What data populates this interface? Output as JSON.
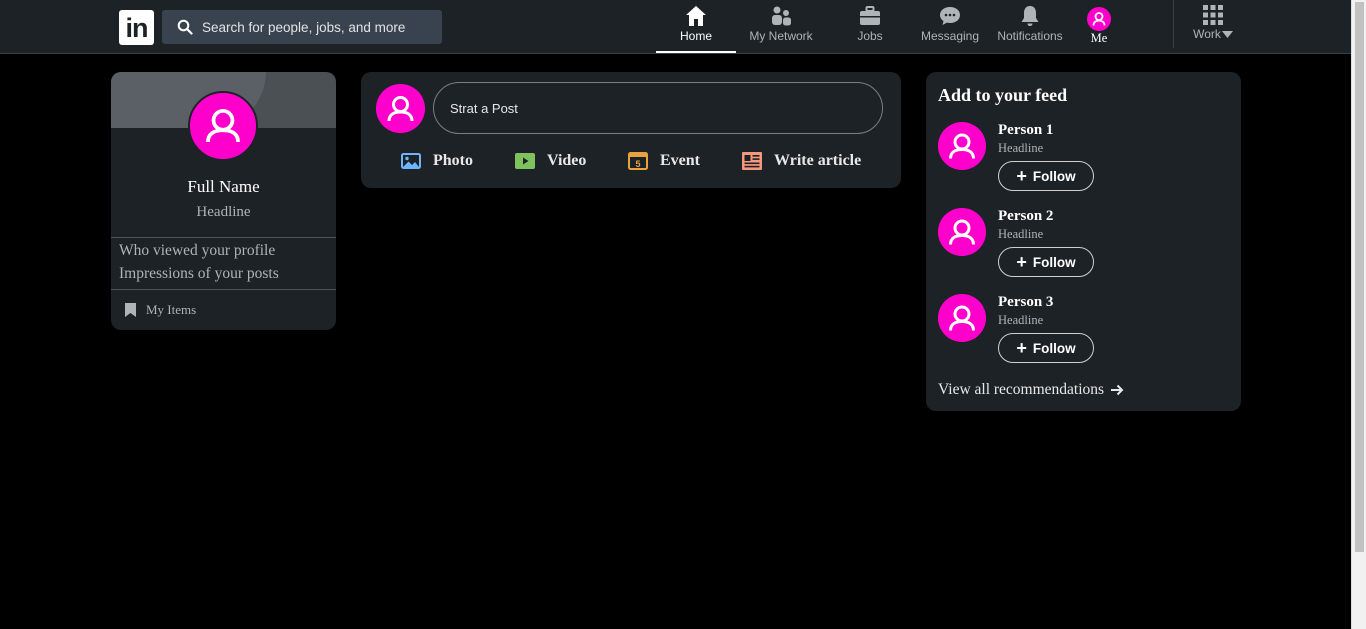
{
  "header": {
    "logo_text": "in",
    "search_placeholder": "Search for people, jobs, and more",
    "nav": [
      {
        "label": "Home",
        "icon": "home-icon",
        "active": true
      },
      {
        "label": "My Network",
        "icon": "network-icon",
        "active": false
      },
      {
        "label": "Jobs",
        "icon": "briefcase-icon",
        "active": false
      },
      {
        "label": "Messaging",
        "icon": "chat-icon",
        "active": false
      },
      {
        "label": "Notifications",
        "icon": "bell-icon",
        "active": false
      },
      {
        "label": "Me",
        "icon": "avatar-icon",
        "active": false
      },
      {
        "label": "Work",
        "icon": "grid-icon",
        "active": false
      }
    ]
  },
  "profile": {
    "name": "Full Name",
    "headline": "Headline",
    "stats": [
      "Who viewed your profile",
      "Impressions of your posts"
    ],
    "my_items": "My Items"
  },
  "post": {
    "input_label": "Strat a Post",
    "actions": [
      {
        "label": "Photo",
        "icon": "photo-icon",
        "color": "#70b5f9"
      },
      {
        "label": "Video",
        "icon": "video-icon",
        "color": "#7fc15e"
      },
      {
        "label": "Event",
        "icon": "calendar-icon",
        "color": "#e7a33e"
      },
      {
        "label": "Write article",
        "icon": "article-icon",
        "color": "#f5987e"
      }
    ]
  },
  "feed": {
    "title": "Add to your feed",
    "people": [
      {
        "name": "Person 1",
        "headline": "Headline",
        "button": "Follow"
      },
      {
        "name": "Person 2",
        "headline": "Headline",
        "button": "Follow"
      },
      {
        "name": "Person 3",
        "headline": "Headline",
        "button": "Follow"
      }
    ],
    "view_all": "View all recommendations"
  },
  "colors": {
    "accent": "#ff00cc",
    "card_bg": "#1d2226",
    "page_bg": "#000000"
  }
}
